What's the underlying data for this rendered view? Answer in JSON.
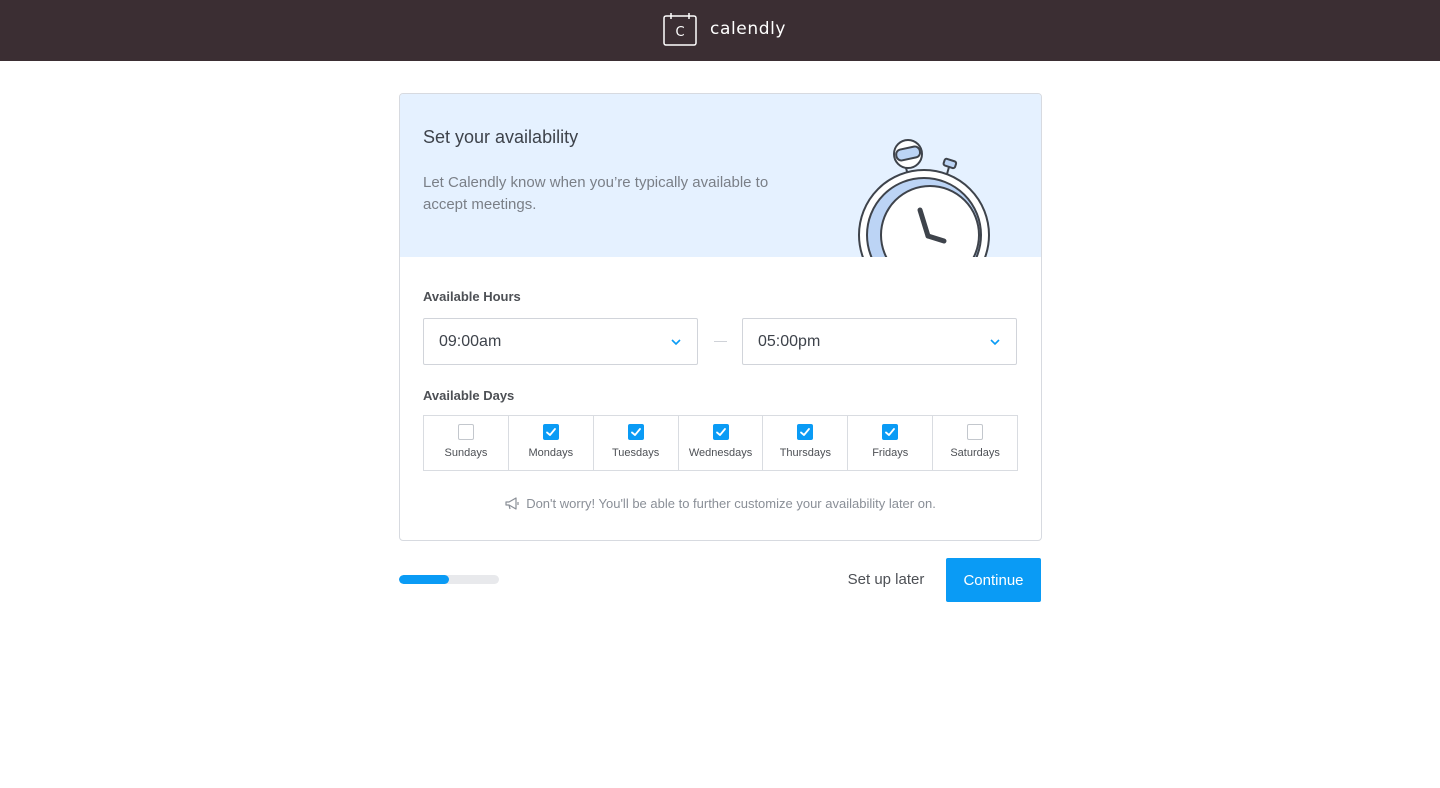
{
  "header": {
    "logo_text": "calendly",
    "logo_letter": "C",
    "background": "#3b2e33"
  },
  "hero": {
    "title": "Set your availability",
    "description": "Let Calendly know when you’re typically available to accept meetings.",
    "illustration": "stopwatch-icon"
  },
  "hours": {
    "label": "Available Hours",
    "start": "09:00am",
    "end": "05:00pm"
  },
  "days": {
    "label": "Available Days",
    "items": [
      {
        "label": "Sundays",
        "checked": false
      },
      {
        "label": "Mondays",
        "checked": true
      },
      {
        "label": "Tuesdays",
        "checked": true
      },
      {
        "label": "Wednesdays",
        "checked": true
      },
      {
        "label": "Thursdays",
        "checked": true
      },
      {
        "label": "Fridays",
        "checked": true
      },
      {
        "label": "Saturdays",
        "checked": false
      }
    ]
  },
  "note": {
    "icon": "megaphone-icon",
    "text": "Don't worry! You'll be able to further customize your availability later on."
  },
  "footer": {
    "progress_fraction": 0.5,
    "setup_later_label": "Set up later",
    "continue_label": "Continue"
  },
  "colors": {
    "accent": "#0a9bf5",
    "hero_background": "#e5f1ff"
  }
}
